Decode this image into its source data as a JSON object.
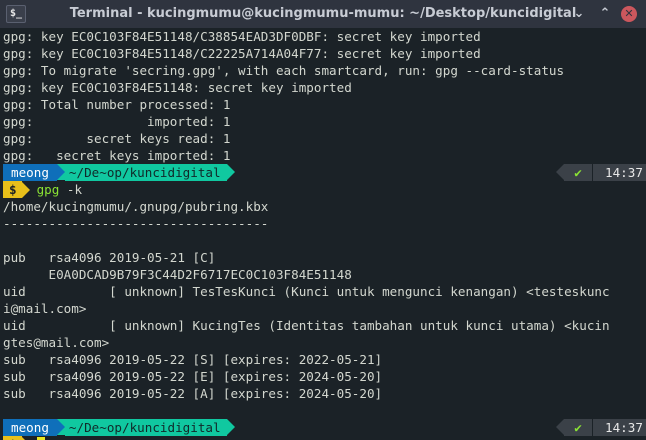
{
  "window": {
    "title": "Terminal - kucingmumu@kucingmumu-mumu: ~/Desktop/kuncidigital",
    "icon_label": "$_",
    "minimize_glyph": "⌄",
    "maximize_glyph": "⌃",
    "close_glyph": "✕"
  },
  "output_before": [
    "gpg: key EC0C103F84E51148/C38854EAD3DF0DBF: secret key imported",
    "gpg: key EC0C103F84E51148/C22225A714A04F77: secret key imported",
    "gpg: To migrate 'secring.gpg', with each smartcard, run: gpg --card-status",
    "gpg: key EC0C103F84E51148: secret key imported",
    "gpg: Total number processed: 1",
    "gpg:               imported: 1",
    "gpg:       secret keys read: 1",
    "gpg:   secret keys imported: 1"
  ],
  "prompt1": {
    "user": "meong",
    "path": "~/De~op/kuncidigital",
    "status": "✔",
    "time": "14:37",
    "symbol": "$",
    "command": "gpg",
    "args": " -k"
  },
  "output_after": [
    "/home/kucingmumu/.gnupg/pubring.kbx",
    "-----------------------------------",
    "",
    "pub   rsa4096 2019-05-21 [C]",
    "      E0A0DCAD9B79F3C44D2F6717EC0C103F84E51148",
    "uid           [ unknown] TesTesKunci (Kunci untuk mengunci kenangan) <testeskunc",
    "i@mail.com>",
    "uid           [ unknown] KucingTes (Identitas tambahan untuk kunci utama) <kucin",
    "gtes@mail.com>",
    "sub   rsa4096 2019-05-22 [S] [expires: 2022-05-21]",
    "sub   rsa4096 2019-05-22 [E] [expires: 2024-05-20]",
    "sub   rsa4096 2019-05-22 [A] [expires: 2024-05-20]",
    ""
  ],
  "prompt2": {
    "user": "meong",
    "path": "~/De~op/kuncidigital",
    "status": "✔",
    "time": "14:37",
    "symbol": "$"
  }
}
